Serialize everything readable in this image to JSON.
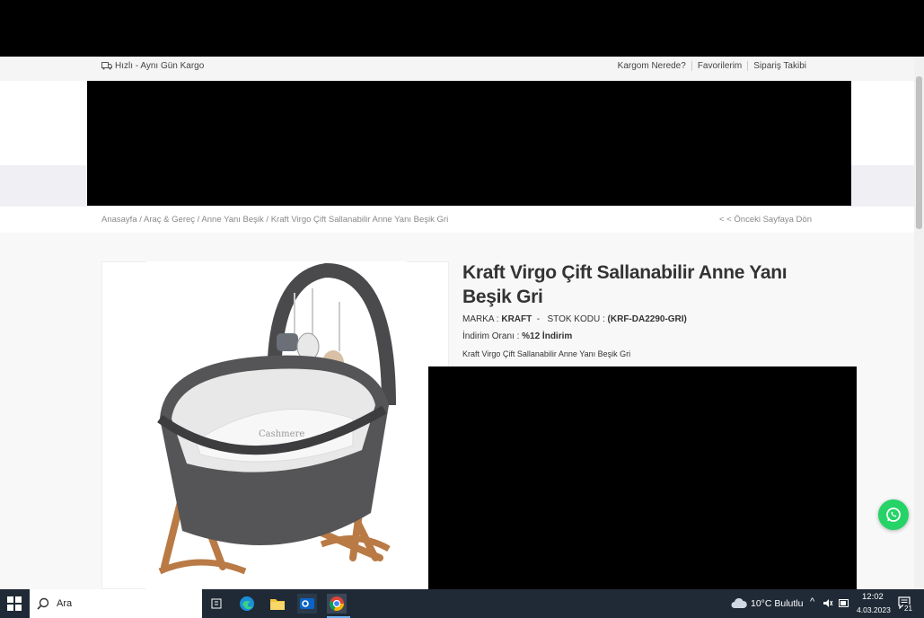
{
  "topbar": {
    "shipping_text": "Hızlı - Aynı Gün Kargo",
    "links": [
      "Kargom Nerede?",
      "Favorilerim",
      "Sipariş Takibi"
    ]
  },
  "breadcrumb": {
    "text": "Anasayfa /  Araç & Gereç / Anne Yanı Beşik / Kraft Virgo Çift Sallanabilir Anne Yanı Beşik Gri",
    "back": "< < Önceki Sayfaya Dön"
  },
  "product": {
    "title": "Kraft Virgo Çift Sallanabilir Anne Yanı Beşik Gri",
    "brand_label": "MARKA : ",
    "brand": "KRAFT",
    "sep": "  -   ",
    "code_label": "STOK KODU : ",
    "code": "(KRF-DA2290-GRI)",
    "discount_label": "İndirim Oranı : ",
    "discount": "%12 İndirim",
    "description": "Kraft Virgo Çift Sallanabilir Anne Yanı Beşik Gri",
    "image_text": "Cashmere"
  },
  "taskbar": {
    "search_text": "Ara",
    "weather": "10°C  Bulutlu",
    "time": "12:02",
    "date": "4.03.2023",
    "notification_count": "21"
  },
  "colors": {
    "whatsapp": "#25d366",
    "taskbar": "#1f2a36"
  }
}
